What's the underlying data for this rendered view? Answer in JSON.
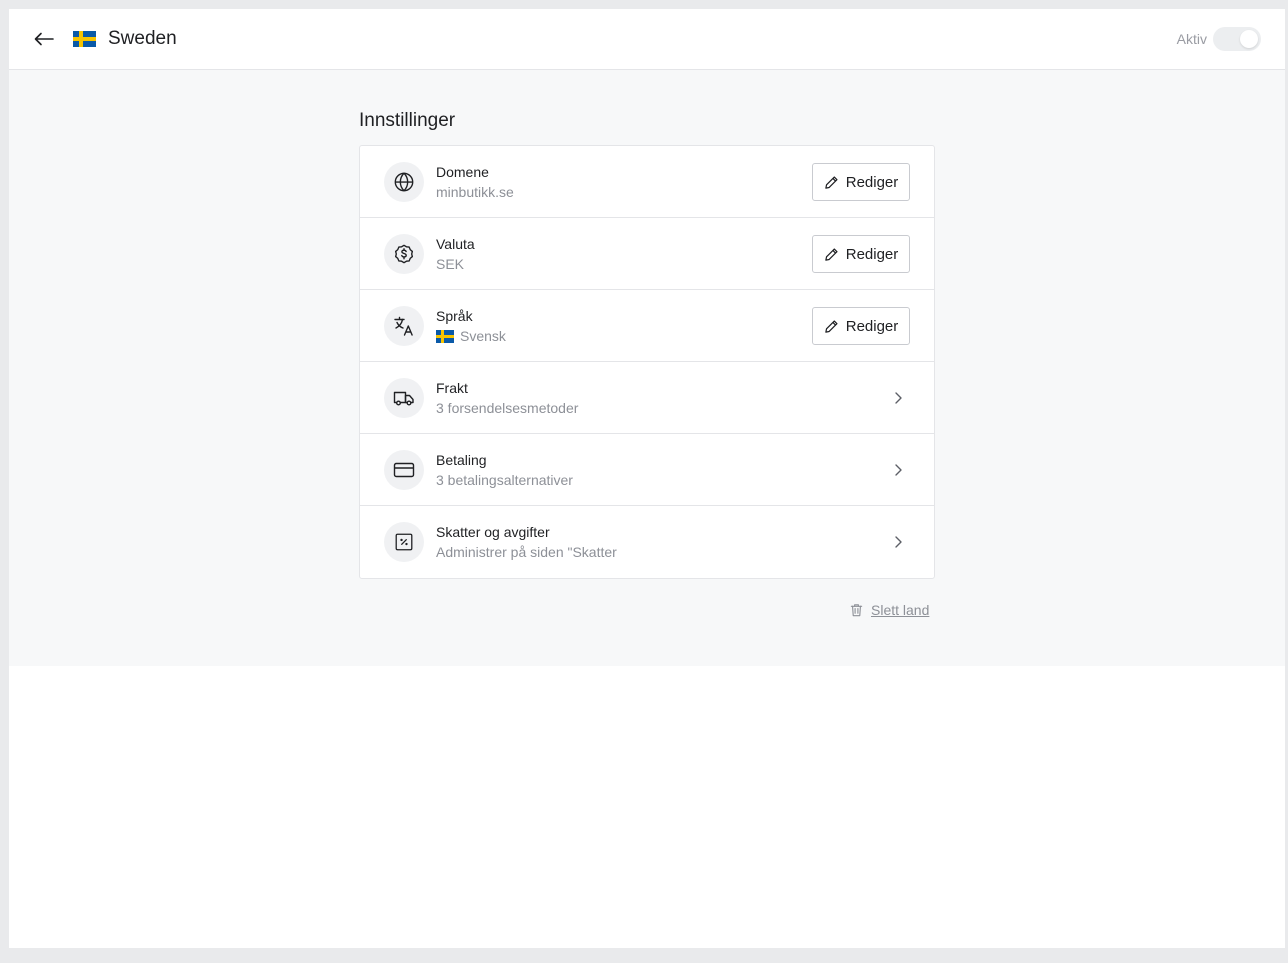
{
  "header": {
    "back_icon": "arrow-left-icon",
    "title": "Sweden",
    "status_label": "Aktiv",
    "toggle_on": false
  },
  "colors": {
    "flag_blue": "#0a5aa8",
    "flag_yellow": "#f6c400",
    "page_bg": "#f7f8f9",
    "border": "#e4e5e8",
    "muted_text": "#8d9097"
  },
  "settings": {
    "heading": "Innstillinger",
    "edit_label": "Rediger",
    "rows": [
      {
        "icon": "globe-icon",
        "label": "Domene",
        "value": "minbutikk.se",
        "action": "edit"
      },
      {
        "icon": "currency-icon",
        "label": "Valuta",
        "value": "SEK",
        "action": "edit"
      },
      {
        "icon": "translate-icon",
        "label": "Språk",
        "value": "Svensk",
        "action": "edit"
      },
      {
        "icon": "truck-icon",
        "label": "Frakt",
        "value": "3 forsendelsesmetoder",
        "action": "navigate"
      },
      {
        "icon": "credit-card-icon",
        "label": "Betaling",
        "value": "3 betalingsalternativer",
        "action": "navigate"
      },
      {
        "icon": "tax-icon",
        "label": "Skatter og avgifter",
        "value": "Administrer på siden \"Skatter",
        "action": "navigate"
      }
    ]
  },
  "delete": {
    "icon": "trash-icon",
    "label": "Slett land"
  }
}
